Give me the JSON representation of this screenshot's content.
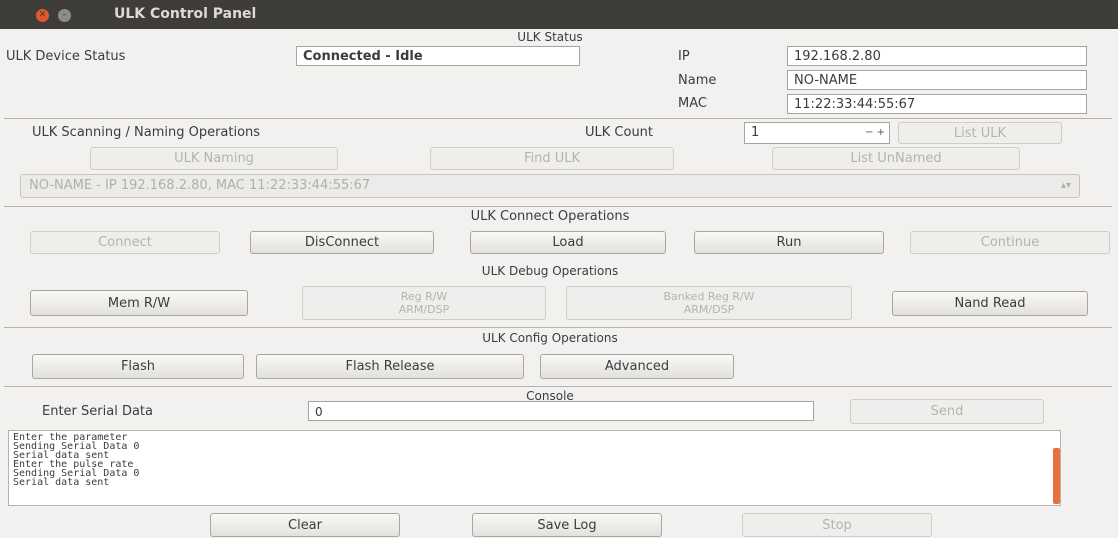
{
  "window": {
    "title": "ULK Control Panel",
    "close_glyph": "✕",
    "min_glyph": "–"
  },
  "status": {
    "header": "ULK Status",
    "device_status_label": "ULK Device Status",
    "device_status_value": "Connected - Idle",
    "ip_label": "IP",
    "ip_value": "192.168.2.80",
    "name_label": "Name",
    "name_value": "NO-NAME",
    "mac_label": "MAC",
    "mac_value": "11:22:33:44:55:67"
  },
  "scanning": {
    "header": "ULK Scanning / Naming Operations",
    "count_label": "ULK Count",
    "count_value": "1",
    "list_ulk": "List ULK",
    "ulk_naming": "ULK Naming",
    "find_ulk": "Find ULK",
    "list_unnamed": "List UnNamed",
    "device_select": "NO-NAME - IP 192.168.2.80, MAC 11:22:33:44:55:67"
  },
  "connect_ops": {
    "header": "ULK Connect Operations",
    "connect": "Connect",
    "disconnect": "DisConnect",
    "load": "Load",
    "run": "Run",
    "continue": "Continue"
  },
  "debug_ops": {
    "header": "ULK Debug Operations",
    "mem_rw": "Mem R/W",
    "reg_rw_line1": "Reg R/W",
    "reg_rw_line2": "ARM/DSP",
    "banked_line1": "Banked Reg R/W",
    "banked_line2": "ARM/DSP",
    "nand_read": "Nand Read"
  },
  "config_ops": {
    "header": "ULK Config Operations",
    "flash": "Flash",
    "flash_release": "Flash Release",
    "advanced": "Advanced"
  },
  "console": {
    "header": "Console",
    "serial_label": "Enter Serial Data",
    "serial_value": "0",
    "send": "Send",
    "lines": [
      "Enter the parameter",
      "Sending Serial Data 0",
      "Serial data sent",
      "Enter the pulse rate",
      "Sending Serial Data 0",
      "Serial data sent"
    ],
    "clear": "Clear",
    "save_log": "Save Log",
    "stop": "Stop"
  }
}
